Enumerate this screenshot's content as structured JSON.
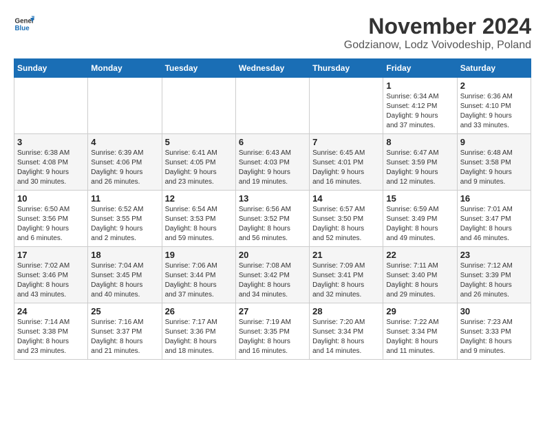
{
  "header": {
    "logo_line1": "General",
    "logo_line2": "Blue",
    "month_title": "November 2024",
    "location": "Godzianow, Lodz Voivodeship, Poland"
  },
  "weekdays": [
    "Sunday",
    "Monday",
    "Tuesday",
    "Wednesday",
    "Thursday",
    "Friday",
    "Saturday"
  ],
  "weeks": [
    [
      {
        "day": "",
        "info": ""
      },
      {
        "day": "",
        "info": ""
      },
      {
        "day": "",
        "info": ""
      },
      {
        "day": "",
        "info": ""
      },
      {
        "day": "",
        "info": ""
      },
      {
        "day": "1",
        "info": "Sunrise: 6:34 AM\nSunset: 4:12 PM\nDaylight: 9 hours\nand 37 minutes."
      },
      {
        "day": "2",
        "info": "Sunrise: 6:36 AM\nSunset: 4:10 PM\nDaylight: 9 hours\nand 33 minutes."
      }
    ],
    [
      {
        "day": "3",
        "info": "Sunrise: 6:38 AM\nSunset: 4:08 PM\nDaylight: 9 hours\nand 30 minutes."
      },
      {
        "day": "4",
        "info": "Sunrise: 6:39 AM\nSunset: 4:06 PM\nDaylight: 9 hours\nand 26 minutes."
      },
      {
        "day": "5",
        "info": "Sunrise: 6:41 AM\nSunset: 4:05 PM\nDaylight: 9 hours\nand 23 minutes."
      },
      {
        "day": "6",
        "info": "Sunrise: 6:43 AM\nSunset: 4:03 PM\nDaylight: 9 hours\nand 19 minutes."
      },
      {
        "day": "7",
        "info": "Sunrise: 6:45 AM\nSunset: 4:01 PM\nDaylight: 9 hours\nand 16 minutes."
      },
      {
        "day": "8",
        "info": "Sunrise: 6:47 AM\nSunset: 3:59 PM\nDaylight: 9 hours\nand 12 minutes."
      },
      {
        "day": "9",
        "info": "Sunrise: 6:48 AM\nSunset: 3:58 PM\nDaylight: 9 hours\nand 9 minutes."
      }
    ],
    [
      {
        "day": "10",
        "info": "Sunrise: 6:50 AM\nSunset: 3:56 PM\nDaylight: 9 hours\nand 6 minutes."
      },
      {
        "day": "11",
        "info": "Sunrise: 6:52 AM\nSunset: 3:55 PM\nDaylight: 9 hours\nand 2 minutes."
      },
      {
        "day": "12",
        "info": "Sunrise: 6:54 AM\nSunset: 3:53 PM\nDaylight: 8 hours\nand 59 minutes."
      },
      {
        "day": "13",
        "info": "Sunrise: 6:56 AM\nSunset: 3:52 PM\nDaylight: 8 hours\nand 56 minutes."
      },
      {
        "day": "14",
        "info": "Sunrise: 6:57 AM\nSunset: 3:50 PM\nDaylight: 8 hours\nand 52 minutes."
      },
      {
        "day": "15",
        "info": "Sunrise: 6:59 AM\nSunset: 3:49 PM\nDaylight: 8 hours\nand 49 minutes."
      },
      {
        "day": "16",
        "info": "Sunrise: 7:01 AM\nSunset: 3:47 PM\nDaylight: 8 hours\nand 46 minutes."
      }
    ],
    [
      {
        "day": "17",
        "info": "Sunrise: 7:02 AM\nSunset: 3:46 PM\nDaylight: 8 hours\nand 43 minutes."
      },
      {
        "day": "18",
        "info": "Sunrise: 7:04 AM\nSunset: 3:45 PM\nDaylight: 8 hours\nand 40 minutes."
      },
      {
        "day": "19",
        "info": "Sunrise: 7:06 AM\nSunset: 3:44 PM\nDaylight: 8 hours\nand 37 minutes."
      },
      {
        "day": "20",
        "info": "Sunrise: 7:08 AM\nSunset: 3:42 PM\nDaylight: 8 hours\nand 34 minutes."
      },
      {
        "day": "21",
        "info": "Sunrise: 7:09 AM\nSunset: 3:41 PM\nDaylight: 8 hours\nand 32 minutes."
      },
      {
        "day": "22",
        "info": "Sunrise: 7:11 AM\nSunset: 3:40 PM\nDaylight: 8 hours\nand 29 minutes."
      },
      {
        "day": "23",
        "info": "Sunrise: 7:12 AM\nSunset: 3:39 PM\nDaylight: 8 hours\nand 26 minutes."
      }
    ],
    [
      {
        "day": "24",
        "info": "Sunrise: 7:14 AM\nSunset: 3:38 PM\nDaylight: 8 hours\nand 23 minutes."
      },
      {
        "day": "25",
        "info": "Sunrise: 7:16 AM\nSunset: 3:37 PM\nDaylight: 8 hours\nand 21 minutes."
      },
      {
        "day": "26",
        "info": "Sunrise: 7:17 AM\nSunset: 3:36 PM\nDaylight: 8 hours\nand 18 minutes."
      },
      {
        "day": "27",
        "info": "Sunrise: 7:19 AM\nSunset: 3:35 PM\nDaylight: 8 hours\nand 16 minutes."
      },
      {
        "day": "28",
        "info": "Sunrise: 7:20 AM\nSunset: 3:34 PM\nDaylight: 8 hours\nand 14 minutes."
      },
      {
        "day": "29",
        "info": "Sunrise: 7:22 AM\nSunset: 3:34 PM\nDaylight: 8 hours\nand 11 minutes."
      },
      {
        "day": "30",
        "info": "Sunrise: 7:23 AM\nSunset: 3:33 PM\nDaylight: 8 hours\nand 9 minutes."
      }
    ]
  ]
}
